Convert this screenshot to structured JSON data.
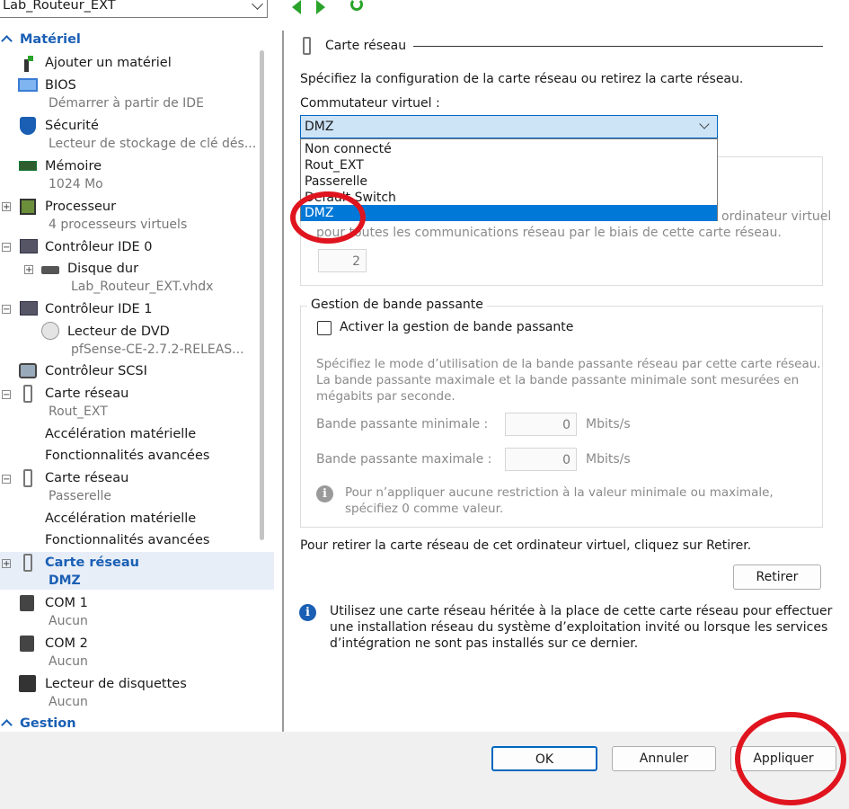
{
  "header": {
    "vm_name": "Lab_Routeur_EXT"
  },
  "sidebar": {
    "section_materiel": "Matériel",
    "section_gestion": "Gestion",
    "items": [
      {
        "label": "Ajouter un matériel"
      },
      {
        "label": "BIOS",
        "sub": "Démarrer à partir de IDE"
      },
      {
        "label": "Sécurité",
        "sub": "Lecteur de stockage de clé dés..."
      },
      {
        "label": "Mémoire",
        "sub": "1024 Mo"
      },
      {
        "label": "Processeur",
        "sub": "4 processeurs virtuels"
      },
      {
        "label": "Contrôleur IDE 0"
      },
      {
        "label": "Disque dur",
        "sub": "Lab_Routeur_EXT.vhdx"
      },
      {
        "label": "Contrôleur IDE 1"
      },
      {
        "label": "Lecteur de DVD",
        "sub": "pfSense-CE-2.7.2-RELEAS..."
      },
      {
        "label": "Contrôleur SCSI"
      },
      {
        "label": "Carte réseau",
        "sub": "Rout_EXT"
      },
      {
        "label": "Accélération matérielle"
      },
      {
        "label": "Fonctionnalités avancées"
      },
      {
        "label": "Carte réseau",
        "sub": "Passerelle"
      },
      {
        "label": "Accélération matérielle"
      },
      {
        "label": "Fonctionnalités avancées"
      },
      {
        "label": "Carte réseau",
        "sub": "DMZ"
      },
      {
        "label": "COM 1",
        "sub": "Aucun"
      },
      {
        "label": "COM 2",
        "sub": "Aucun"
      },
      {
        "label": "Lecteur de disquettes",
        "sub": "Aucun"
      }
    ]
  },
  "main": {
    "section_title": "Carte réseau",
    "intro": "Spécifiez la configuration de la carte réseau ou retirez la carte réseau.",
    "switch_label": "Commutateur virtuel :",
    "switch_value": "DMZ",
    "switch_options": [
      "Non connecté",
      "Rout_EXT",
      "Passerelle",
      "Default Switch",
      "DMZ"
    ],
    "vlan_text_1": "ordinateur virtuel",
    "vlan_text_2": "pour toutes les communications réseau par le biais de cette carte réseau.",
    "vlan_value": "2",
    "bandwidth": {
      "title": "Gestion de bande passante",
      "checkbox_label": "Activer la gestion de bande passante",
      "desc_1": "Spécifiez le mode d’utilisation de la bande passante réseau par cette carte réseau.",
      "desc_2": "La bande passante maximale et la bande passante minimale sont mesurées en",
      "desc_3": "mégabits par seconde.",
      "min_label": "Bande passante minimale :",
      "min_value": "0",
      "max_label": "Bande passante maximale :",
      "max_value": "0",
      "unit": "Mbits/s",
      "note_1": "Pour n’appliquer aucune restriction à la valeur minimale ou maximale,",
      "note_2": "spécifiez 0 comme valeur."
    },
    "remove_text": "Pour retirer la carte réseau de cet ordinateur virtuel, cliquez sur Retirer.",
    "remove_button": "Retirer",
    "legacy_1": "Utilisez une carte réseau héritée à la place de cette carte réseau pour effectuer",
    "legacy_2": "une installation réseau du système d’exploitation invité ou lorsque les services",
    "legacy_3": "d’intégration ne sont pas installés sur ce dernier."
  },
  "footer": {
    "ok": "OK",
    "cancel": "Annuler",
    "apply": "Appliquer"
  },
  "colors": {
    "accent": "#1a5fb4",
    "highlight": "#0078d7",
    "annotation": "#e0141e",
    "nav_green": "#2aa32a"
  }
}
